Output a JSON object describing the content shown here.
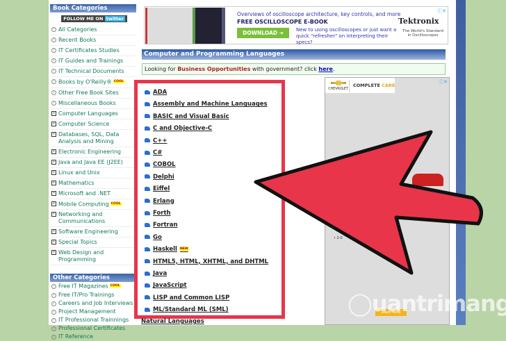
{
  "sidebar": {
    "header": "Book Categories",
    "twitter": {
      "text": "FOLLOW ME ON",
      "brand": "twitter"
    },
    "items": [
      {
        "label": "All Categories"
      },
      {
        "label": "Recent Books"
      },
      {
        "label": "IT Certificates Studies"
      },
      {
        "label": "IT Guides and Trainings"
      },
      {
        "label": "IT Technical Documents"
      },
      {
        "label": "Books by O'Reilly®",
        "badge": "COOL"
      },
      {
        "label": "Other Free Book Sites"
      },
      {
        "label": "Miscellaneous Books"
      }
    ],
    "expandable": [
      {
        "label": "Computer Languages"
      },
      {
        "label": "Computer Science"
      },
      {
        "label": "Databases, SQL, Data Analysis and Mining"
      },
      {
        "label": "Electronic Engineering"
      },
      {
        "label": "Java and Java EE (J2EE)"
      },
      {
        "label": "Linux and Unix"
      },
      {
        "label": "Mathematics"
      },
      {
        "label": "Microsoft and .NET"
      },
      {
        "label": "Mobile Computing",
        "badge": "COOL"
      },
      {
        "label": "Networking and Communications"
      },
      {
        "label": "Software Engineering"
      },
      {
        "label": "Special Topics"
      },
      {
        "label": "Web Design and Programming"
      }
    ],
    "other_header": "Other Categories",
    "other": [
      {
        "label": "Free IT Magazines",
        "badge": "COOL"
      },
      {
        "label": "Free IT/Pro Trainings"
      },
      {
        "label": "Careers and Job Interviews"
      },
      {
        "label": "Project Management"
      },
      {
        "label": "IT Professional Trainnings"
      },
      {
        "label": "Professional Certificates"
      },
      {
        "label": "IT Reference"
      }
    ]
  },
  "ad_top": {
    "line1": "Overviews of oscilloscope architecture, key controls, and more",
    "line2": "FREE OSCILLOSCOPE E-BOOK",
    "button": "DOWNLOAD",
    "line3": "New to using oscilloscopes or just want a quick \"refresher\" on interpreting their specs?",
    "brand": "Tektronix",
    "tagline": "The World's Standard in Oscilloscopes"
  },
  "main": {
    "title": "Computer and Programming Languages",
    "notice": {
      "prefix": "Looking for ",
      "bold": "Business Opportunities",
      "middle": " with government? click ",
      "link": "here",
      "suffix": "."
    },
    "languages": [
      {
        "label": "ADA"
      },
      {
        "label": "Assembly and Machine Languages"
      },
      {
        "label": "BASIC and Visual Basic"
      },
      {
        "label": "C and Objective-C"
      },
      {
        "label": "C++"
      },
      {
        "label": "C#"
      },
      {
        "label": "COBOL"
      },
      {
        "label": "Delphi"
      },
      {
        "label": "Eiffel"
      },
      {
        "label": "Erlang"
      },
      {
        "label": "Forth"
      },
      {
        "label": "Fortran"
      },
      {
        "label": "Go"
      },
      {
        "label": "Haskell",
        "badge": "NEW"
      },
      {
        "label": "HTML5, HTML, XHTML, and DHTML"
      },
      {
        "label": "Java"
      },
      {
        "label": "JavaScript"
      },
      {
        "label": "LISP and Common LISP"
      },
      {
        "label": "ML/Standard ML (SML)"
      }
    ],
    "next_item": "Natural Languages"
  },
  "ad_side": {
    "brand": "CHEVROLET",
    "headline_a": "COMPLETE ",
    "headline_b": "CARE",
    "bullet": "• 2-0",
    "button": "Learn More"
  },
  "watermark": "uantrimang",
  "colors": {
    "arrow": "#e8354a",
    "link": "#117a55",
    "header": "#2d5aa8"
  }
}
